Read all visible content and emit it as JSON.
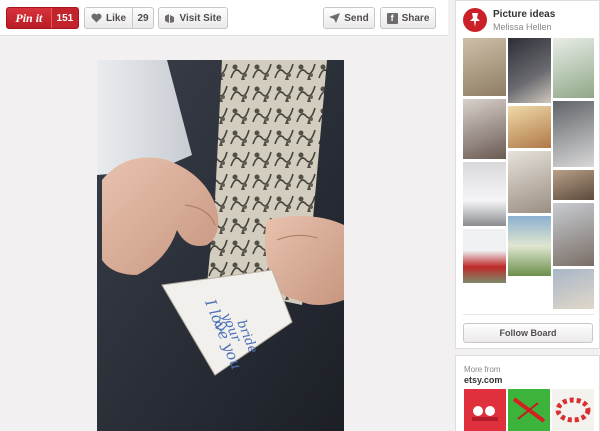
{
  "toolbar": {
    "pinit_label": "Pin it",
    "pinit_count": "151",
    "like_label": "Like",
    "like_count": "29",
    "visit_label": "Visit Site",
    "send_label": "Send",
    "share_label": "Share"
  },
  "pin": {
    "handwriting_line1": "I love you",
    "handwriting_line2": "your",
    "handwriting_line3": "bride"
  },
  "board": {
    "title": "Picture ideas",
    "owner": "Melissa Hellen",
    "follow_label": "Follow Board"
  },
  "more": {
    "label": "More from",
    "source": "etsy.com"
  },
  "colors": {
    "brand_red": "#cb2027",
    "toolbar_bg": "#ffffff",
    "page_bg": "#f2f0f0"
  },
  "icons": {
    "like": "heart-icon",
    "visit": "globe-icon",
    "send": "paper-plane-icon",
    "share": "facebook-icon",
    "board": "pushpin-icon"
  }
}
